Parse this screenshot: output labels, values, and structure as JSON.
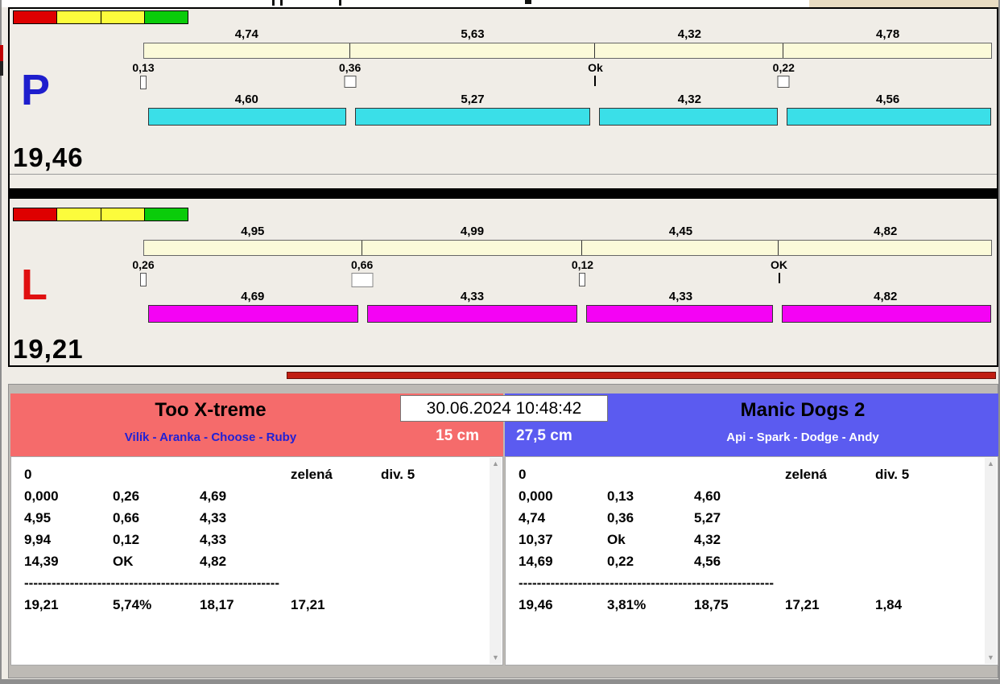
{
  "icons": {
    "scroll_up": "▲",
    "scroll_down": "▼"
  },
  "panels": {
    "p": {
      "letter": "P",
      "letter_color": "#1E1ECD",
      "total_time": "19,46",
      "bar_color": "#3ADFE8",
      "lights": [
        "#DE0000",
        "#FCFC3C",
        "#FCFC3C",
        "#0ACC0A"
      ],
      "splits_top": [
        "4,74",
        "5,63",
        "4,32",
        "4,78"
      ],
      "gaps": [
        "0,13",
        "0,36",
        "Ok",
        "0,22"
      ],
      "markers": [
        "slim",
        "box",
        "tick",
        "box"
      ],
      "splits_bottom": [
        "4,60",
        "5,27",
        "4,32",
        "4,56"
      ]
    },
    "l": {
      "letter": "L",
      "letter_color": "#E01010",
      "total_time": "19,21",
      "bar_color": "#F403F4",
      "lights": [
        "#DE0000",
        "#FCFC3C",
        "#FCFC3C",
        "#0ACC0A"
      ],
      "splits_top": [
        "4,95",
        "4,99",
        "4,45",
        "4,82"
      ],
      "gaps": [
        "0,26",
        "0,66",
        "0,12",
        "OK"
      ],
      "markers": [
        "slim",
        "boxwide",
        "slim",
        "tick"
      ],
      "splits_bottom": [
        "4,69",
        "4,33",
        "4,33",
        "4,82"
      ]
    }
  },
  "progress_bar": {
    "color": "#C01E12"
  },
  "scoreboard": {
    "datetime": "30.06.2024 10:48:42",
    "left": {
      "team_name": "Too X-treme",
      "dog_names": "Vilík - Aranka - Choose - Ruby",
      "jump_height": "15 cm",
      "header_color": "#F56B6B",
      "dog_names_color": "#2121D6",
      "rows": [
        [
          "0",
          "",
          "",
          "zelená",
          "div. 5"
        ],
        [
          "0,000",
          "0,26",
          "4,69",
          "",
          ""
        ],
        [
          "4,95",
          "0,66",
          "4,33",
          "",
          ""
        ],
        [
          "9,94",
          "0,12",
          "4,33",
          "",
          ""
        ],
        [
          "14,39",
          "OK",
          "4,82",
          "",
          ""
        ],
        [
          "--------------------------------------------------------"
        ],
        [
          "19,21",
          "5,74%",
          "18,17",
          "17,21",
          ""
        ]
      ]
    },
    "right": {
      "team_name": "Manic Dogs 2",
      "dog_names": "Api - Spark - Dodge - Andy",
      "jump_height": "27,5 cm",
      "header_color": "#5B5BF0",
      "dog_names_color": "#FFFFFF",
      "rows": [
        [
          "0",
          "",
          "",
          "zelená",
          "div. 5"
        ],
        [
          "0,000",
          "0,13",
          "4,60",
          "",
          ""
        ],
        [
          "4,74",
          "0,36",
          "5,27",
          "",
          ""
        ],
        [
          "10,37",
          "Ok",
          "4,32",
          "",
          ""
        ],
        [
          "14,69",
          "0,22",
          "4,56",
          "",
          ""
        ],
        [
          "--------------------------------------------------------"
        ],
        [
          "19,46",
          "3,81%",
          "18,75",
          "17,21",
          "1,84"
        ]
      ]
    }
  }
}
